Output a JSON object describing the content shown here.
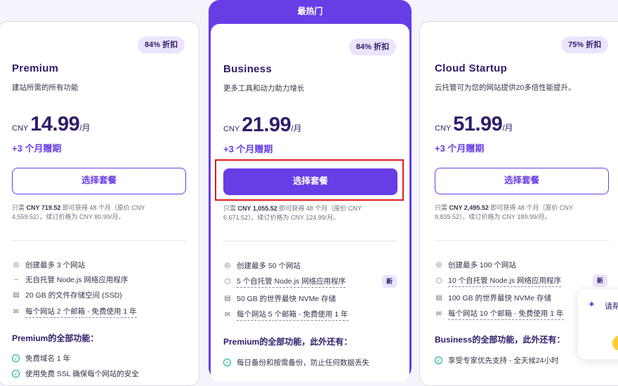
{
  "plans": [
    {
      "badge": "84% 折扣",
      "name": "Premium",
      "desc": "建站所需的所有功能",
      "currency": "CNY",
      "price": "14.99",
      "period": "/月",
      "bonus": "+3 个月赠期",
      "button": "选择套餐",
      "fine_pre": "只需",
      "fine_amount": "CNY 719.52",
      "fine_post": "即可获得 48 个月（原价 CNY 4,559.52）。续订价格为 CNY 80.99/月。",
      "features": [
        {
          "icon": "globe-icon",
          "text": "创建最多 3 个网站"
        },
        {
          "icon": "dash-icon",
          "text": "无自托管 Node.js 网络应用程序"
        },
        {
          "icon": "database-icon",
          "text": "20 GB 的文件存储空间 (SSD)"
        },
        {
          "icon": "mail-icon",
          "text": "每个网站 2 个邮箱 - 免费使用 1 年"
        }
      ],
      "section_title": "Premium的全部功能：",
      "extras": [
        "免费域名 1 年",
        "使用免费 SSL 确保每个网站的安全"
      ]
    },
    {
      "badge": "84% 折扣",
      "name": "Business",
      "desc": "更多工具和动力助力增长",
      "currency": "CNY",
      "price": "21.99",
      "period": "/月",
      "bonus": "+3 个月赠期",
      "button": "选择套餐",
      "fine_pre": "只需",
      "fine_amount": "CNY 1,055.52",
      "fine_post": "即可获得 48 个月（原价 CNY 6,671.52）。续订价格为 CNY 124.99/月。",
      "features": [
        {
          "icon": "globe-icon",
          "text": "创建最多 50 个网站"
        },
        {
          "icon": "node-icon",
          "text": "5 个自托管 Node.js 网络应用程序",
          "new": "新"
        },
        {
          "icon": "database-icon",
          "text": "50 GB 的世界最快 NVMe 存储"
        },
        {
          "icon": "mail-icon",
          "text": "每个网站 5 个邮箱 - 免费使用 1 年"
        }
      ],
      "section_title": "Premium的全部功能，此外还有：",
      "extras": [
        "每日备份和按需备份，防止任何数据丢失"
      ]
    },
    {
      "badge": "75% 折扣",
      "name": "Cloud Startup",
      "desc": "云托管可为您的网站提供20多倍性能提升。",
      "currency": "CNY",
      "price": "51.99",
      "period": "/月",
      "bonus": "+3 个月赠期",
      "button": "选择套餐",
      "fine_pre": "只需",
      "fine_amount": "CNY 2,495.52",
      "fine_post": "即可获得 48 个月（原价 CNY 9,839.52）。续订价格为 CNY 189.99/月。",
      "features": [
        {
          "icon": "globe-icon",
          "text": "创建最多 100 个网站"
        },
        {
          "icon": "node-icon",
          "text": "10 个自托管 Node.js 网络应用程序",
          "new": "新"
        },
        {
          "icon": "database-icon",
          "text": "100 GB 的世界最快 NVMe 存储"
        },
        {
          "icon": "mail-icon",
          "text": "每个网站 10 个邮箱 - 免费使用 1 年"
        }
      ],
      "section_title": "Business的全部功能，此外还有：",
      "extras": [
        "享受专家优先支持 - 全天候24小时"
      ]
    }
  ],
  "featured_label": "最热门",
  "chat": {
    "text": "请帮"
  },
  "colors": {
    "accent": "#673de6",
    "highlight": "#e01b1b"
  }
}
